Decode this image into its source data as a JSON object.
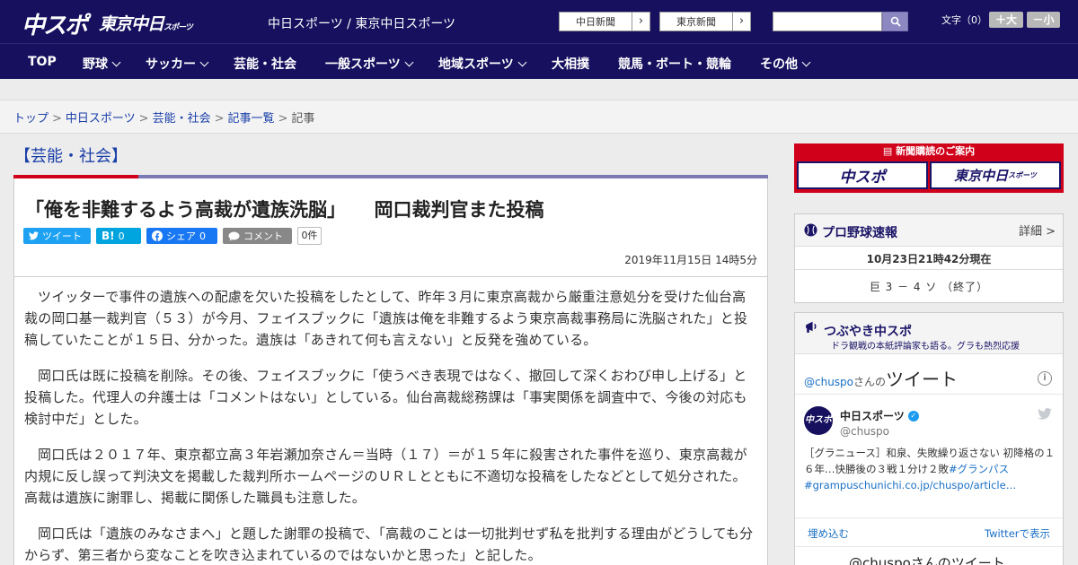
{
  "header": {
    "logo_chu": "中スポ",
    "logo_tokyo": "東京中日",
    "logo_tokyo_sub": "スポーツ",
    "site_label": "中日スポーツ / 東京中日スポーツ",
    "btn_chunichi": "中日新聞",
    "btn_tokyo": "東京新聞",
    "search_placeholder": "",
    "moji_label": "文字（0）",
    "size_up": "＋大",
    "size_down": "－小"
  },
  "nav": {
    "items": [
      {
        "label": "TOP"
      },
      {
        "label": "野球"
      },
      {
        "label": "サッカー"
      },
      {
        "label": "芸能・社会"
      },
      {
        "label": "一般スポーツ"
      },
      {
        "label": "地域スポーツ"
      },
      {
        "label": "大相撲"
      },
      {
        "label": "競馬・ボート・競輪"
      },
      {
        "label": "その他"
      }
    ]
  },
  "breadcrumb": {
    "items": [
      "トップ",
      "中日スポーツ",
      "芸能・社会",
      "記事一覧"
    ],
    "current": "記事"
  },
  "article": {
    "category": "【芸能・社会】",
    "headline": "「俺を非難するよう高裁が遺族洗脳」　　岡口裁判官また投稿",
    "share": {
      "tweet": "ツイート",
      "hatena": "B!",
      "hatena_count": "0",
      "facebook": "シェア",
      "facebook_count": "0",
      "comment": "コメント",
      "comment_count": "0件"
    },
    "date": "2019年11月15日 14時5分",
    "paragraphs": [
      "ツイッターで事件の遺族への配慮を欠いた投稿をしたとして、昨年３月に東京高裁から厳重注意処分を受けた仙台高裁の岡口基一裁判官（５３）が今月、フェイスブックに「遺族は俺を非難するよう東京高裁事務局に洗脳された」と投稿していたことが１５日、分かった。遺族は「あきれて何も言えない」と反発を強めている。",
      "岡口氏は既に投稿を削除。その後、フェイスブックに「使うべき表現ではなく、撤回して深くおわび申し上げる」と投稿した。代理人の弁護士は「コメントはない」としている。仙台高裁総務課は「事実関係を調査中で、今後の対応も検討中だ」とした。",
      "岡口氏は２０１７年、東京都立高３年岩瀬加奈さん＝当時（１７）＝が１５年に殺害された事件を巡り、東京高裁が内規に反し誤って判決文を掲載した裁判所ホームページのＵＲＬとともに不適切な投稿をしたなどとして処分された。高裁は遺族に謝罪し、掲載に関係した職員も注意した。",
      "岡口氏は「遺族のみなさまへ」と題した謝罪の投稿で、「高裁のことは一切批判せず私を批判する理由がどうしても分からず、第三者から変なことを吹き込まれているのではないかと思った」と記した。"
    ]
  },
  "sidebar": {
    "promo": {
      "title": "新聞購読のご案内",
      "btn_chu": "中スポ",
      "btn_tokyo": "東京中日",
      "btn_tokyo_sub": "スポーツ"
    },
    "baseball": {
      "title": "プロ野球速報",
      "detail": "詳細 >",
      "time": "10月23日21時42分現在",
      "score": "巨 3 － 4 ソ （終了）"
    },
    "tsubuyaki": {
      "title": "つぶやき中スポ",
      "subtitle": "ドラ観戦の本紙評論家も語る。グラも熱烈応援",
      "handle": "@chuspo",
      "handle_suffix": "さんの",
      "tweet_word": "ツイート",
      "name": "中日スポーツ",
      "user": "@chuspo",
      "avatar": "中スポ",
      "text_1": "［グラニュース］和泉、失敗繰り返さない 初降格の１６年…快勝後の３戦１分け２敗",
      "hashtag": "#グランパス",
      "link": "#grampuschunichi.co.jp/chuspo/article…",
      "embed": "埋め込む",
      "view_on": "Twitterで表示",
      "more": "@chuspoさんのツイート"
    }
  }
}
